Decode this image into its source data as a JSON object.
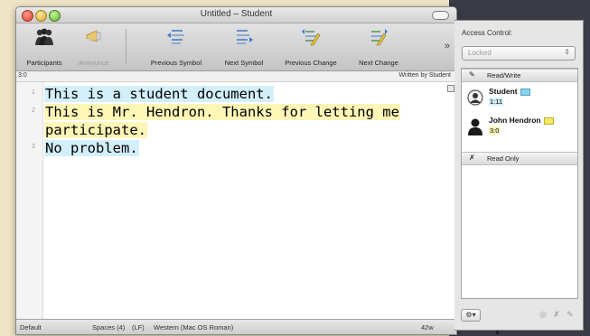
{
  "window": {
    "title": "Untitled – Student"
  },
  "toolbar": {
    "buttons": [
      {
        "label": "Participants",
        "icon": "participants-icon",
        "enabled": true
      },
      {
        "label": "Announce",
        "icon": "megaphone-icon",
        "enabled": false
      },
      {
        "label": "Previous Symbol",
        "icon": "previous-symbol-icon",
        "enabled": true
      },
      {
        "label": "Next Symbol",
        "icon": "next-symbol-icon",
        "enabled": true
      },
      {
        "label": "Previous Change",
        "icon": "previous-change-icon",
        "enabled": true
      },
      {
        "label": "Next Change",
        "icon": "next-change-icon",
        "enabled": true
      }
    ],
    "overflow": "»"
  },
  "infobar": {
    "position": "3:0",
    "author": "Written by Student"
  },
  "editor": {
    "lines": [
      {
        "num": "1",
        "text": "This is a student document.",
        "author": "student"
      },
      {
        "num": "2",
        "text": "This is Mr. Hendron. Thanks for letting me",
        "author": "hendron"
      },
      {
        "num": "",
        "text": "participate.",
        "author": "hendron"
      },
      {
        "num": "3",
        "text": "No problem.",
        "author": "student"
      }
    ]
  },
  "status": {
    "mode": "Default",
    "tabs": "Spaces (4)",
    "line_ending": "(LF)",
    "encoding": "Western (Mac OS Roman)",
    "word_count": "42w"
  },
  "drawer": {
    "access_control_label": "Access Control:",
    "access_value": "Locked",
    "group_readwrite": "Read/Write",
    "group_readonly": "Read Only",
    "participants": [
      {
        "name": "Student",
        "selection": "1:11",
        "color": "#7fd6f2"
      },
      {
        "name": "John Hendron",
        "selection": "3:0",
        "color": "#f5ea5c"
      }
    ]
  },
  "colors": {
    "student_highlight": "#d3effa",
    "hendron_highlight": "#fdf6b7"
  }
}
